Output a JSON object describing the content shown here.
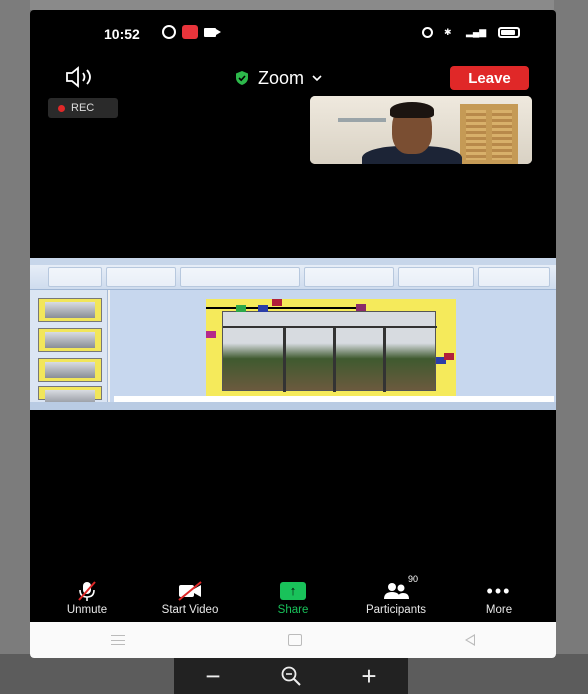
{
  "status_bar": {
    "time": "10:52",
    "network_label": "4G",
    "signal_label": "⁴⁶"
  },
  "header": {
    "app_title": "Zoom",
    "leave_label": "Leave",
    "rec_label": "REC",
    "shield_color": "#2db84b",
    "leave_color": "#e02828"
  },
  "toolbar": {
    "items": [
      {
        "label": "Unmute",
        "icon": "mic-muted-icon"
      },
      {
        "label": "Start Video",
        "icon": "video-off-icon"
      },
      {
        "label": "Share",
        "icon": "share-arrow-icon"
      },
      {
        "label": "Participants",
        "icon": "participants-icon",
        "count": "90"
      },
      {
        "label": "More",
        "icon": "more-dots-icon"
      }
    ],
    "share_color": "#19c25a"
  },
  "zoom_controls": {
    "minus": "−",
    "plus": "+"
  }
}
